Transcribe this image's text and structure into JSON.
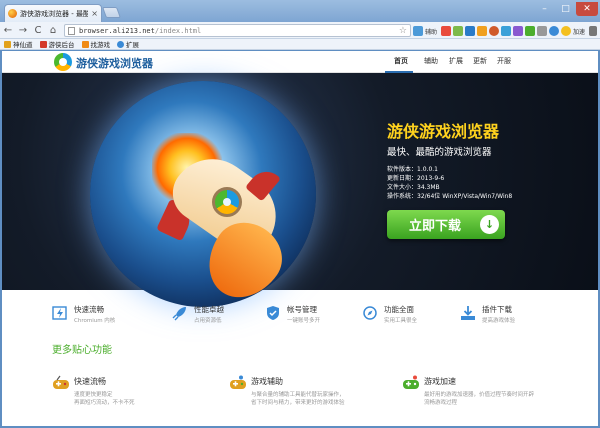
{
  "tab": {
    "title": "游侠游戏浏览器 - 最酷",
    "close": "×"
  },
  "window": {
    "minimize": "–",
    "maximize": "□",
    "close": "✕"
  },
  "toolbar": {
    "back": "←",
    "forward": "→",
    "reload": "C",
    "home": "⌂",
    "url_host": "browser.ali213.net",
    "url_path": "/index.html",
    "star": "☆",
    "ext_label": "辅助",
    "ext_label2": "加速"
  },
  "bookmarks": [
    {
      "label": "神仙道",
      "color": "#e2a21c"
    },
    {
      "label": "游侠后台",
      "color": "#d43a2a"
    },
    {
      "label": "找游戏",
      "color": "#f08a14"
    },
    {
      "label": "扩展",
      "color": "#3a8ad6"
    }
  ],
  "site": {
    "brand": "游侠游戏浏览器",
    "nav": [
      "首页",
      "辅助",
      "扩展",
      "更新",
      "开服"
    ],
    "active_nav": "首页"
  },
  "hero": {
    "title": "游侠游戏浏览器",
    "subtitle": "最快、最酷的游戏浏览器",
    "info": [
      "软件版本：1.0.0.1",
      "更新日期：2013-9-6",
      "文件大小：34.3MB",
      "操作系统：32/64位 WinXP/Vista/Win7/Win8"
    ],
    "download": "立即下载",
    "download_arrow": "↓"
  },
  "features": [
    {
      "name": "快速流畅",
      "desc": "Chromium 内核",
      "icon": "lightning-icon"
    },
    {
      "name": "性能卓越",
      "desc": "占用资源低",
      "icon": "rocket-icon"
    },
    {
      "name": "帐号管理",
      "desc": "一键账号多开",
      "icon": "shield-icon"
    },
    {
      "name": "功能全面",
      "desc": "实用工具很全",
      "icon": "compass-icon"
    },
    {
      "name": "插件下载",
      "desc": "提高游戏体验",
      "icon": "download-icon"
    }
  ],
  "more_title": "更多贴心功能",
  "cards": [
    {
      "name": "快速流畅",
      "desc": [
        "速度更快更稳定",
        "再面短巧流动，不卡不死"
      ],
      "icon": "gamepad-icon"
    },
    {
      "name": "游戏辅助",
      "desc": [
        "与聚合量的辅助工具能代替玩家操作，",
        "省下时间与精力，带来更好的游戏体验"
      ],
      "icon": "game-assist-icon"
    },
    {
      "name": "游戏加速",
      "desc": [
        "最好用的游戏加速器，价值过程节奏时间开辟",
        "流畅游戏过程"
      ],
      "icon": "game-speed-icon"
    }
  ],
  "colors": {
    "brand_blue": "#1e5f9e",
    "accent_green": "#4cae2d",
    "hero_yellow": "#ffd21e"
  }
}
